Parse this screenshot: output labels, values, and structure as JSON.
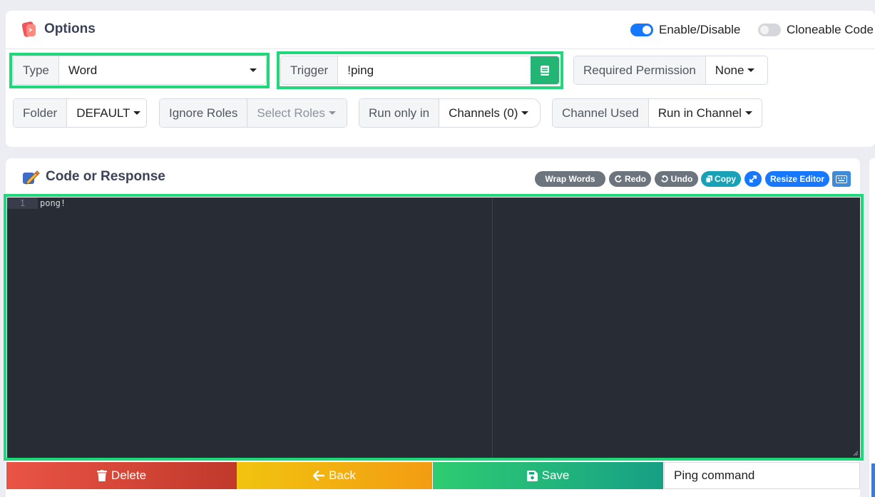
{
  "options": {
    "title": "Options",
    "enable_label": "Enable/Disable",
    "cloneable_label": "Cloneable Code",
    "type": {
      "label": "Type",
      "value": "Word"
    },
    "trigger": {
      "label": "Trigger",
      "value": "!ping"
    },
    "required_permission": {
      "label": "Required Permission",
      "value": "None"
    },
    "folder": {
      "label": "Folder",
      "value": "DEFAULT"
    },
    "ignore_roles": {
      "label": "Ignore Roles",
      "value": "Select Roles"
    },
    "run_only_in": {
      "label": "Run only in",
      "value": "Channels (0)"
    },
    "channel_used": {
      "label": "Channel Used",
      "value": "Run in Channel"
    }
  },
  "code": {
    "title": "Code or Response",
    "toolbar": {
      "wrap": "Wrap Words",
      "redo": "Redo",
      "undo": "Undo",
      "copy": "Copy",
      "resize": "Resize Editor"
    },
    "line_number": "1",
    "line_text": "pong!"
  },
  "actions": {
    "delete": "Delete",
    "back": "Back",
    "save": "Save",
    "description": "Ping command"
  },
  "colors": {
    "highlight": "#1fd87a",
    "toggle_on": "#1677ff",
    "editor_bg": "#282c34"
  }
}
